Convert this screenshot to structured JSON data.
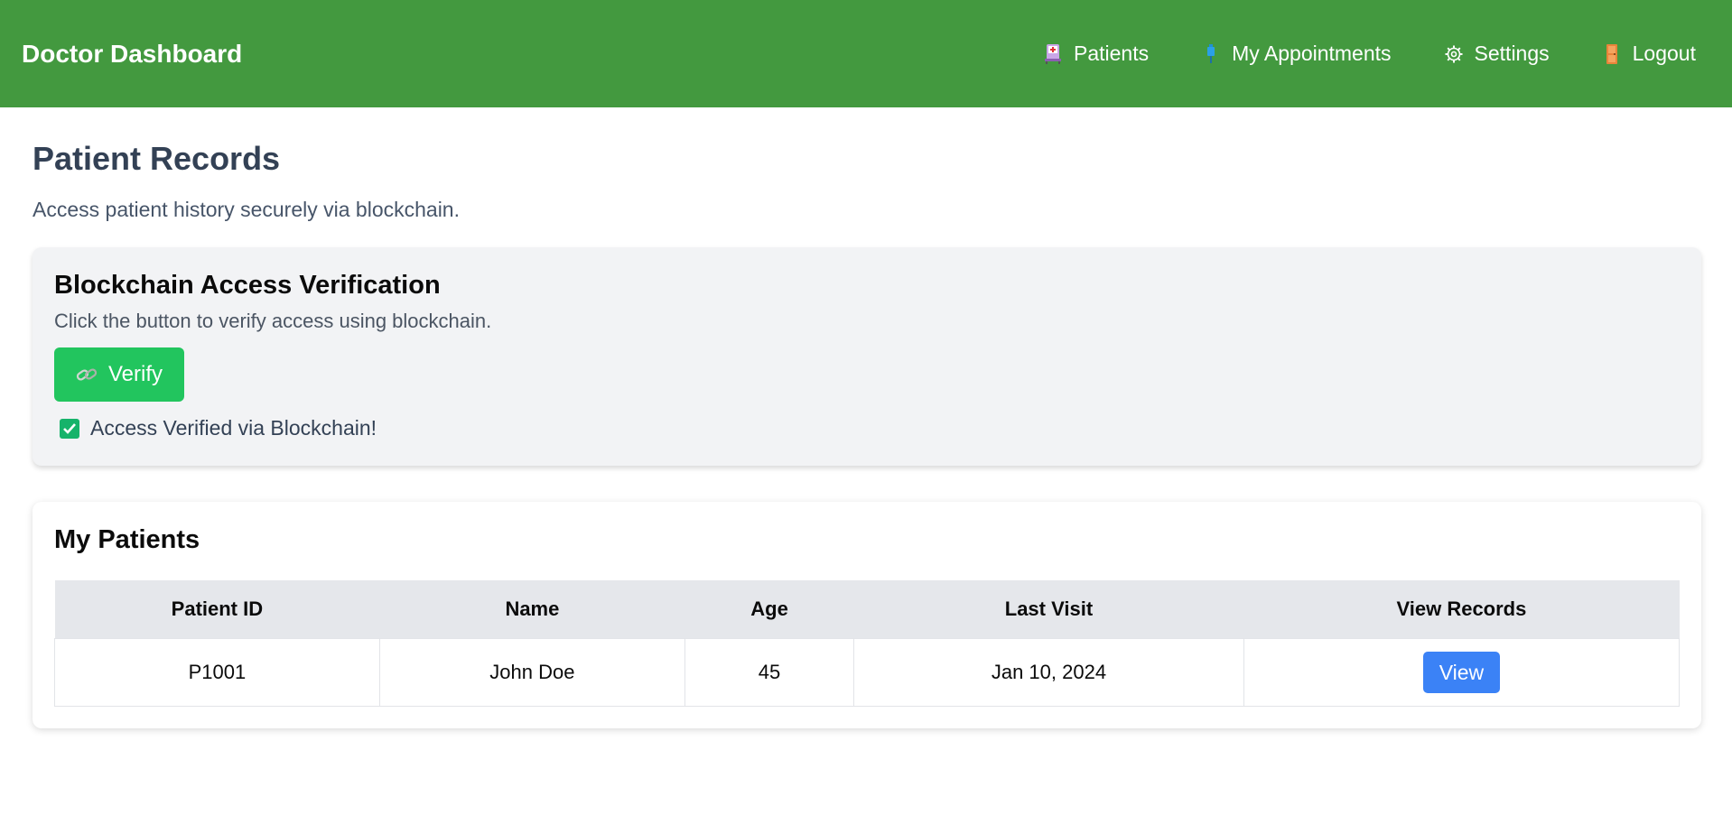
{
  "header": {
    "title": "Doctor Dashboard",
    "nav": [
      {
        "label": "Patients",
        "icon": "hospital-bed-icon"
      },
      {
        "label": "My Appointments",
        "icon": "syringe-icon"
      },
      {
        "label": "Settings",
        "icon": "gear-icon"
      },
      {
        "label": "Logout",
        "icon": "door-icon"
      }
    ],
    "color": "#43993f"
  },
  "page": {
    "title": "Patient Records",
    "subtitle": "Access patient history securely via blockchain."
  },
  "verification": {
    "title": "Blockchain Access Verification",
    "description": "Click the button to verify access using blockchain.",
    "button_label": "Verify",
    "button_icon": "link-icon",
    "status_text": "Access Verified via Blockchain!",
    "status_icon": "check-icon",
    "button_color": "#22c55e"
  },
  "patients": {
    "title": "My Patients",
    "columns": [
      "Patient ID",
      "Name",
      "Age",
      "Last Visit",
      "View Records"
    ],
    "rows": [
      {
        "id": "P1001",
        "name": "John Doe",
        "age": "45",
        "last_visit": "Jan 10, 2024",
        "action": "View"
      }
    ],
    "action_color": "#3b82f6"
  }
}
